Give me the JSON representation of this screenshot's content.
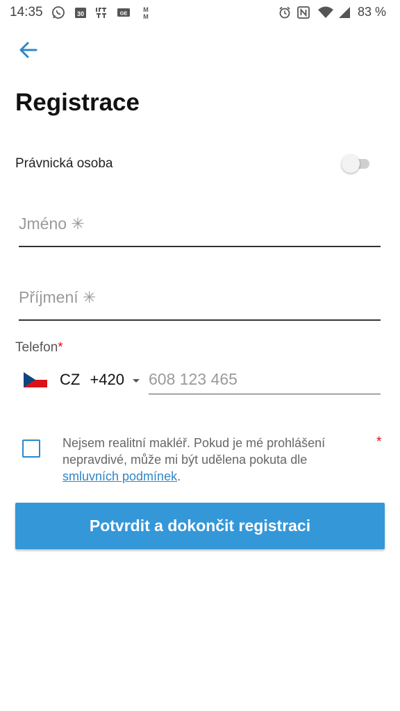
{
  "status_bar": {
    "time": "14:35",
    "battery": "83 %",
    "icons": [
      "whatsapp-icon",
      "calendar-30-icon",
      "ifttt-icon",
      "gmail-icon",
      "mm-app-icon",
      "alarm-icon",
      "nfc-icon",
      "wifi-icon",
      "cell-signal-icon"
    ]
  },
  "header": {
    "back_icon": "arrow-left-icon",
    "title": "Registrace"
  },
  "legal_entity": {
    "label": "Právnická osoba",
    "enabled": false
  },
  "fields": {
    "first_name": {
      "placeholder": "Jméno ✳",
      "value": ""
    },
    "last_name": {
      "placeholder": "Příjmení ✳",
      "value": ""
    }
  },
  "phone": {
    "label": "Telefon",
    "required_mark": "*",
    "country_code": "CZ",
    "dial_code": "+420",
    "placeholder": "608 123 465",
    "value": ""
  },
  "agent_declaration": {
    "checked": false,
    "text": "Nejsem realitní makléř. Pokud je mé prohlášení nepravdivé, může mi být udělena pokuta dle ",
    "link_text": "smluvních podmínek",
    "suffix": ".",
    "required_mark": "*"
  },
  "submit": {
    "label": "Potvrdit a dokončit registraci"
  },
  "colors": {
    "accent": "#3497d8",
    "required": "#dd1111"
  }
}
